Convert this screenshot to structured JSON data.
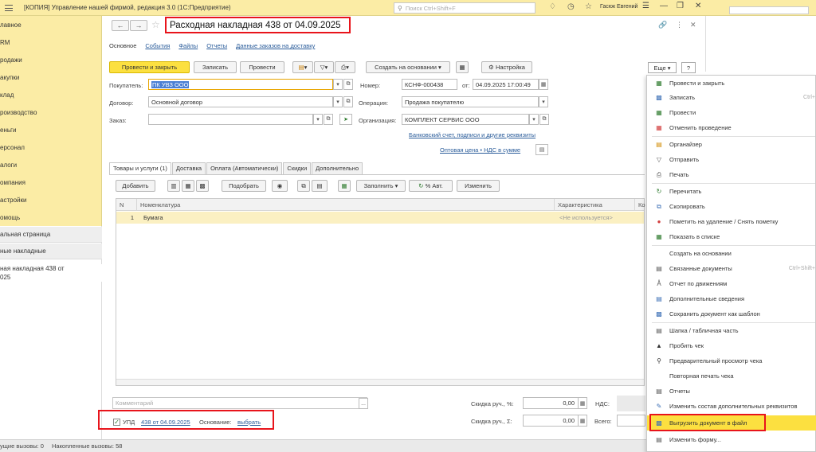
{
  "titlebar": {
    "app_title": "[КОПИЯ] Управление нашей фирмой, редакция 3.0  (1С:Предприятие)",
    "search_placeholder": "Поиск Ctrl+Shift+F",
    "user": "Гасюк Евгений"
  },
  "sidebar": {
    "items": [
      "лавное",
      "RM",
      "родажи",
      "акупки",
      "клад",
      "роизводство",
      "еньги",
      "ерсонал",
      "алоги",
      "омпания",
      "астройки",
      "омощь"
    ]
  },
  "leftlist": {
    "items": [
      "альная страница",
      "ные накладные"
    ],
    "active_line1": "ная накладная 438 от",
    "active_line2": "025"
  },
  "document": {
    "title": "Расходная накладная 438 от 04.09.2025",
    "tabs": [
      "Основное",
      "События",
      "Файлы",
      "Отчеты",
      "Данные заказов на доставку"
    ]
  },
  "toolbar": {
    "post_close": "Провести и закрыть",
    "save": "Записать",
    "post": "Провести",
    "create_based": "Создать на основании",
    "settings": "Настройка",
    "more": "Еще",
    "help": "?"
  },
  "fields": {
    "buyer_label": "Покупатель:",
    "buyer_value": "ПК УВЗ ООО",
    "contract_label": "Договор:",
    "contract_value": "Основной договор",
    "order_label": "Заказ:",
    "number_label": "Номер:",
    "number_value": "КСНФ-000438",
    "date_label": "от:",
    "date_value": "04.09.2025 17:00:49",
    "operation_label": "Операция:",
    "operation_value": "Продажа покупателю",
    "org_label": "Организация:",
    "org_value": "КОМПЛЕКТ СЕРВИС ООО",
    "bank_link": "Банковский счет, подписи и другие реквизиты",
    "price_link": "Оптовая цена • НДС в сумме"
  },
  "subtabs": [
    "Товары и услуги (1)",
    "Доставка",
    "Оплата (Автоматически)",
    "Скидки",
    "Дополнительно"
  ],
  "table_toolbar": {
    "add": "Добавить",
    "pick": "Подобрать",
    "fill": "Заполнить",
    "auto_pct": "% Авт.",
    "change": "Изменить"
  },
  "table": {
    "headers": [
      "N",
      "Номенклатура",
      "Характеристика",
      "Ко"
    ],
    "rows": [
      {
        "n": "1",
        "name": "Бумага",
        "characteristic": "<Не используется>"
      }
    ]
  },
  "footer": {
    "comment_placeholder": "Комментарий",
    "discount_pct_label": "Скидка руч., %:",
    "discount_pct_value": "0,00",
    "discount_sum_label": "Скидка руч., Σ:",
    "discount_sum_value": "0,00",
    "vat_label": "НДС:",
    "total_label": "Всего:",
    "upd_label": "УПД",
    "upd_link": "438 от 04.09.2025",
    "basis_label": "Основание:",
    "basis_link": "выбрать"
  },
  "statusbar": {
    "current_calls": "ущие вызовы: 0",
    "accumulated_calls": "Накопленные вызовы: 58"
  },
  "menu": {
    "items": [
      {
        "label": "Провести и закрыть",
        "shortcut": "",
        "icon": "post-close-icon"
      },
      {
        "label": "Записать",
        "shortcut": "Ctrl+",
        "icon": "save-icon"
      },
      {
        "label": "Провести",
        "shortcut": "",
        "icon": "post-icon"
      },
      {
        "label": "Отменить проведение",
        "shortcut": "",
        "icon": "unpost-icon"
      },
      {
        "label": "Органайзер",
        "shortcut": "",
        "icon": "organizer-icon"
      },
      {
        "label": "Отправить",
        "shortcut": "",
        "icon": "send-icon"
      },
      {
        "label": "Печать",
        "shortcut": "",
        "icon": "print-icon"
      },
      {
        "label": "Перечитать",
        "shortcut": "",
        "icon": "refresh-icon"
      },
      {
        "label": "Скопировать",
        "shortcut": "",
        "icon": "copy-icon"
      },
      {
        "label": "Пометить на удаление / Снять пометку",
        "shortcut": "",
        "icon": "delete-mark-icon"
      },
      {
        "label": "Показать в списке",
        "shortcut": "",
        "icon": "show-in-list-icon"
      },
      {
        "label": "Создать на основании",
        "shortcut": "",
        "icon": ""
      },
      {
        "label": "Связанные документы",
        "shortcut": "Ctrl+Shift+",
        "icon": "linked-docs-icon"
      },
      {
        "label": "Отчет по движениям",
        "shortcut": "",
        "icon": "movement-report-icon"
      },
      {
        "label": "Дополнительные сведения",
        "shortcut": "",
        "icon": "extra-info-icon"
      },
      {
        "label": "Сохранить документ как шаблон",
        "shortcut": "",
        "icon": "save-template-icon"
      },
      {
        "label": "Шапка / табличная часть",
        "shortcut": "",
        "icon": "header-table-icon"
      },
      {
        "label": "Пробить чек",
        "shortcut": "",
        "icon": "receipt-icon"
      },
      {
        "label": "Предварительный просмотр чека",
        "shortcut": "",
        "icon": "preview-icon"
      },
      {
        "label": "Повторная печать чека",
        "shortcut": "",
        "icon": ""
      },
      {
        "label": "Отчеты",
        "shortcut": "",
        "icon": "reports-icon"
      },
      {
        "label": "Изменить состав дополнительных реквизитов",
        "shortcut": "",
        "icon": "edit-attrs-icon"
      },
      {
        "label": "Выгрузить документ в файл",
        "shortcut": "",
        "icon": "export-file-icon"
      },
      {
        "label": "Изменить форму...",
        "shortcut": "",
        "icon": "edit-form-icon"
      }
    ]
  },
  "colors": {
    "sidebar_bg": "#fbeca5",
    "primary_button": "#fce040",
    "highlight_red": "#e8141b",
    "link": "#2a5c9a"
  }
}
